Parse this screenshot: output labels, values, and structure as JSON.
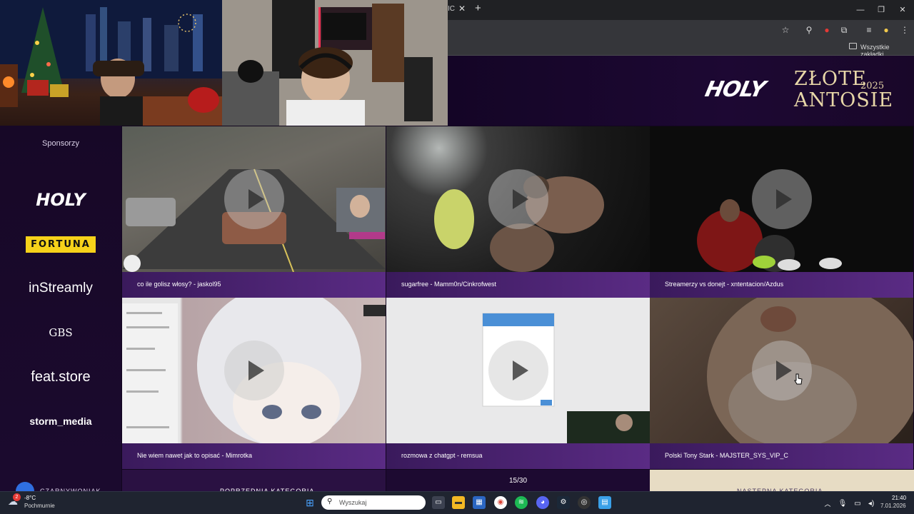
{
  "browser": {
    "tab_fragment": "IC",
    "bookmarks_label": "Wszystkie zakładki"
  },
  "header": {
    "brand": "HOLY",
    "event_line1": "ZŁOTE",
    "event_line2": "ANTOSIE",
    "event_year": "2025"
  },
  "sidebar": {
    "title": "Sponsorzy",
    "sponsors": [
      "HOLY",
      "FORTUNA",
      "inStreamly",
      "GBS",
      "feat.store",
      "storm_media"
    ]
  },
  "clips": [
    {
      "title": "co ile golisz włosy? - jaskol95"
    },
    {
      "title": "sugarfree - Mamm0n/Cinkrofwest"
    },
    {
      "title": "Streamerzy vs donejt - xntentacion/Azdus"
    },
    {
      "title": "Nie wiem nawet jak to opisać - Mimrotka"
    },
    {
      "title": "rozmowa z chatgpt - remsua"
    },
    {
      "title": "Polski Tony Stark - MAJSTER_SYS_VIP_C"
    }
  ],
  "bottom_nav": {
    "user_label": "CZARNYWONIAK",
    "prev_label": "POPRZEDNIA KATEGORIA",
    "page_counter": "15/30",
    "next_label": "NASTĘPNA KATEGORIA"
  },
  "taskbar": {
    "weather_temp": "-8°C",
    "weather_desc": "Pochmurnie",
    "weather_badge": "2",
    "search_placeholder": "Wyszukaj",
    "time": "21:40",
    "date": "7.01.2026"
  },
  "colors": {
    "caption_start": "#3a1a5c",
    "caption_end": "#5a2b84",
    "accent_gold": "#e8d7a8",
    "fortuna_yellow": "#f6d21a"
  }
}
